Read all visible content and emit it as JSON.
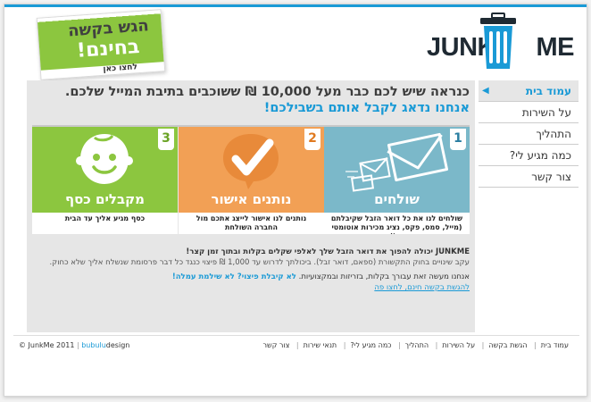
{
  "cta": {
    "line1": "הגש בקשה",
    "line2": "בחינם!",
    "line3": "לחצו כאן"
  },
  "logo": {
    "left": "JUNK",
    "right": "ME"
  },
  "headline": "כנראה שיש לכם כבר מעל 10,000 ₪ ששוכבים בתיבת המייל שלכם.",
  "subhead": "אנחנו נדאג לקבל אותם בשבילכם!",
  "panels": [
    {
      "num": "1",
      "title": "שולחים",
      "desc_line1": "שולחים לנו את כל דואר הזבל שקיבלתם",
      "desc_line2": "(מייל, סמס, פקס, נציג מכירות אוטומטי וכו')",
      "icon": "envelopes-icon"
    },
    {
      "num": "2",
      "title": "נותנים אישור",
      "desc_line1": "נותנים לנו אישור לייצג אתכם מול",
      "desc_line2": "החברה השולחת",
      "icon": "checkmark-icon"
    },
    {
      "num": "3",
      "title": "מקבלים כסף",
      "desc_line1": "כסף מגיע אליך עד הבית",
      "desc_line2": "",
      "icon": "smiley-icon"
    }
  ],
  "body": {
    "line1_brand": "JUNKME",
    "line1_rest": " יכולה להפוך את דואר הזבל שלך לאלפי שקלים בקלות ובתוך זמן קצר!",
    "line2": "עקב שינויים בחוק התקשורת (ספאם, דואר זבל). ביכולתך לדרוש עד 1,000 ₪ פיצוי כנגד כל דבר פרסומת שנשלח אליך שלא כחוק.",
    "line3": "אנחנו מעשה זאת עבורך בקלות, בזריזות ובמקצועיות.",
    "line3_link": "לא קיבלת פיצוי? לא שילמת עמלה!",
    "line4_link": "להגשת בקשה חינם, לחצו פה"
  },
  "nav": {
    "items": [
      {
        "label": "עמוד בית",
        "active": true
      },
      {
        "label": "על השירות"
      },
      {
        "label": "התהליך"
      },
      {
        "label": "כמה מגיע לי?"
      },
      {
        "label": "צור קשר"
      }
    ]
  },
  "footer": {
    "copyright": "© JunkMe 2011",
    "design_a": "bubulu",
    "design_b": "design",
    "links": [
      "עמוד בית",
      "הגשת בקשה",
      "על השירות",
      "התהליך",
      "כמה מגיע לי?",
      "תנאי שירות",
      "צור קשר"
    ]
  },
  "colors": {
    "accent": "#1a9ad6",
    "green": "#8cc63f",
    "orange": "#f2a055",
    "teal": "#7bb8c9"
  }
}
